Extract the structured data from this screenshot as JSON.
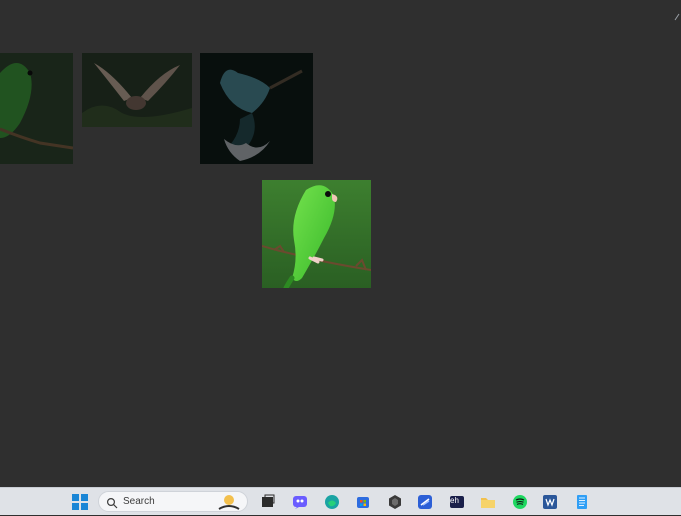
{
  "taskbar": {
    "search_label": "Search",
    "items": [
      {
        "name": "start-button"
      },
      {
        "name": "widgets-icon"
      },
      {
        "name": "task-view-icon"
      },
      {
        "name": "chat-icon"
      },
      {
        "name": "edge-icon"
      },
      {
        "name": "store-icon"
      },
      {
        "name": "app-icon"
      },
      {
        "name": "vscode-icon"
      },
      {
        "name": "terminal-icon"
      },
      {
        "name": "file-explorer-icon"
      },
      {
        "name": "spotify-icon"
      },
      {
        "name": "word-icon"
      },
      {
        "name": "notepad-icon"
      }
    ],
    "terminal_text": "eh"
  },
  "images": [
    {
      "name": "thumbnail-green-parrot-cropped"
    },
    {
      "name": "thumbnail-bird-in-flight"
    },
    {
      "name": "thumbnail-kingfisher"
    },
    {
      "name": "selected-image-green-parrot"
    }
  ],
  "colors": {
    "background": "#2f2f2f",
    "taskbar": "#dfe2e7"
  }
}
